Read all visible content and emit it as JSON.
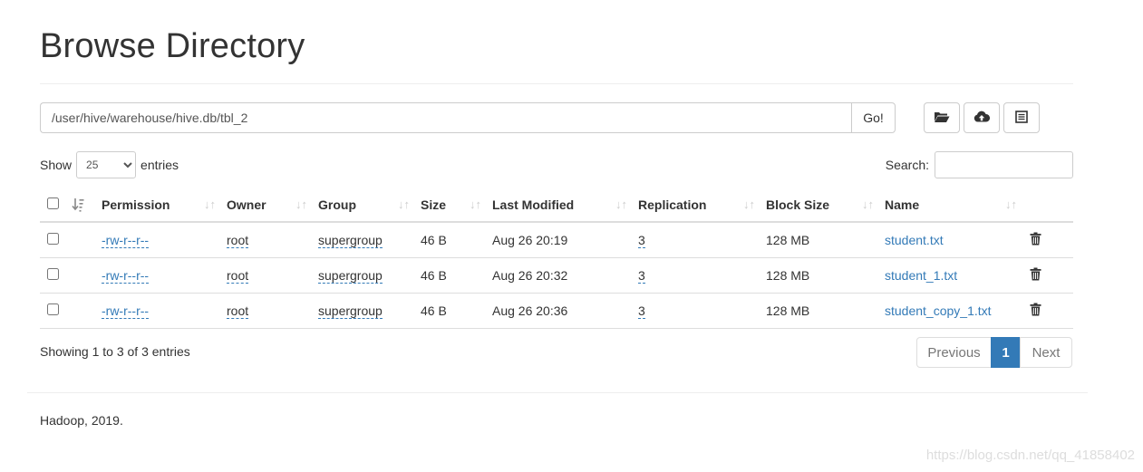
{
  "page": {
    "title": "Browse Directory"
  },
  "path": {
    "value": "/user/hive/warehouse/hive.db/tbl_2",
    "go_label": "Go!"
  },
  "toolbar": {
    "icons": [
      "folder-open-icon",
      "upload-icon",
      "list-icon"
    ]
  },
  "length": {
    "prefix": "Show",
    "selected": "25",
    "suffix": "entries"
  },
  "search": {
    "label": "Search:",
    "value": ""
  },
  "table": {
    "headers": [
      "Permission",
      "Owner",
      "Group",
      "Size",
      "Last Modified",
      "Replication",
      "Block Size",
      "Name"
    ],
    "rows": [
      {
        "permission": "-rw-r--r--",
        "owner": "root",
        "group": "supergroup",
        "size": "46 B",
        "modified": "Aug 26 20:19",
        "replication": "3",
        "block_size": "128 MB",
        "name": "student.txt"
      },
      {
        "permission": "-rw-r--r--",
        "owner": "root",
        "group": "supergroup",
        "size": "46 B",
        "modified": "Aug 26 20:32",
        "replication": "3",
        "block_size": "128 MB",
        "name": "student_1.txt"
      },
      {
        "permission": "-rw-r--r--",
        "owner": "root",
        "group": "supergroup",
        "size": "46 B",
        "modified": "Aug 26 20:36",
        "replication": "3",
        "block_size": "128 MB",
        "name": "student_copy_1.txt"
      }
    ]
  },
  "info": "Showing 1 to 3 of 3 entries",
  "pagination": {
    "previous": "Previous",
    "current": "1",
    "next": "Next"
  },
  "footer": "Hadoop, 2019.",
  "watermark": "https://blog.csdn.net/qq_41858402",
  "colors": {
    "link": "#337ab7",
    "active_page": "#337ab7",
    "border": "#dddddd"
  }
}
